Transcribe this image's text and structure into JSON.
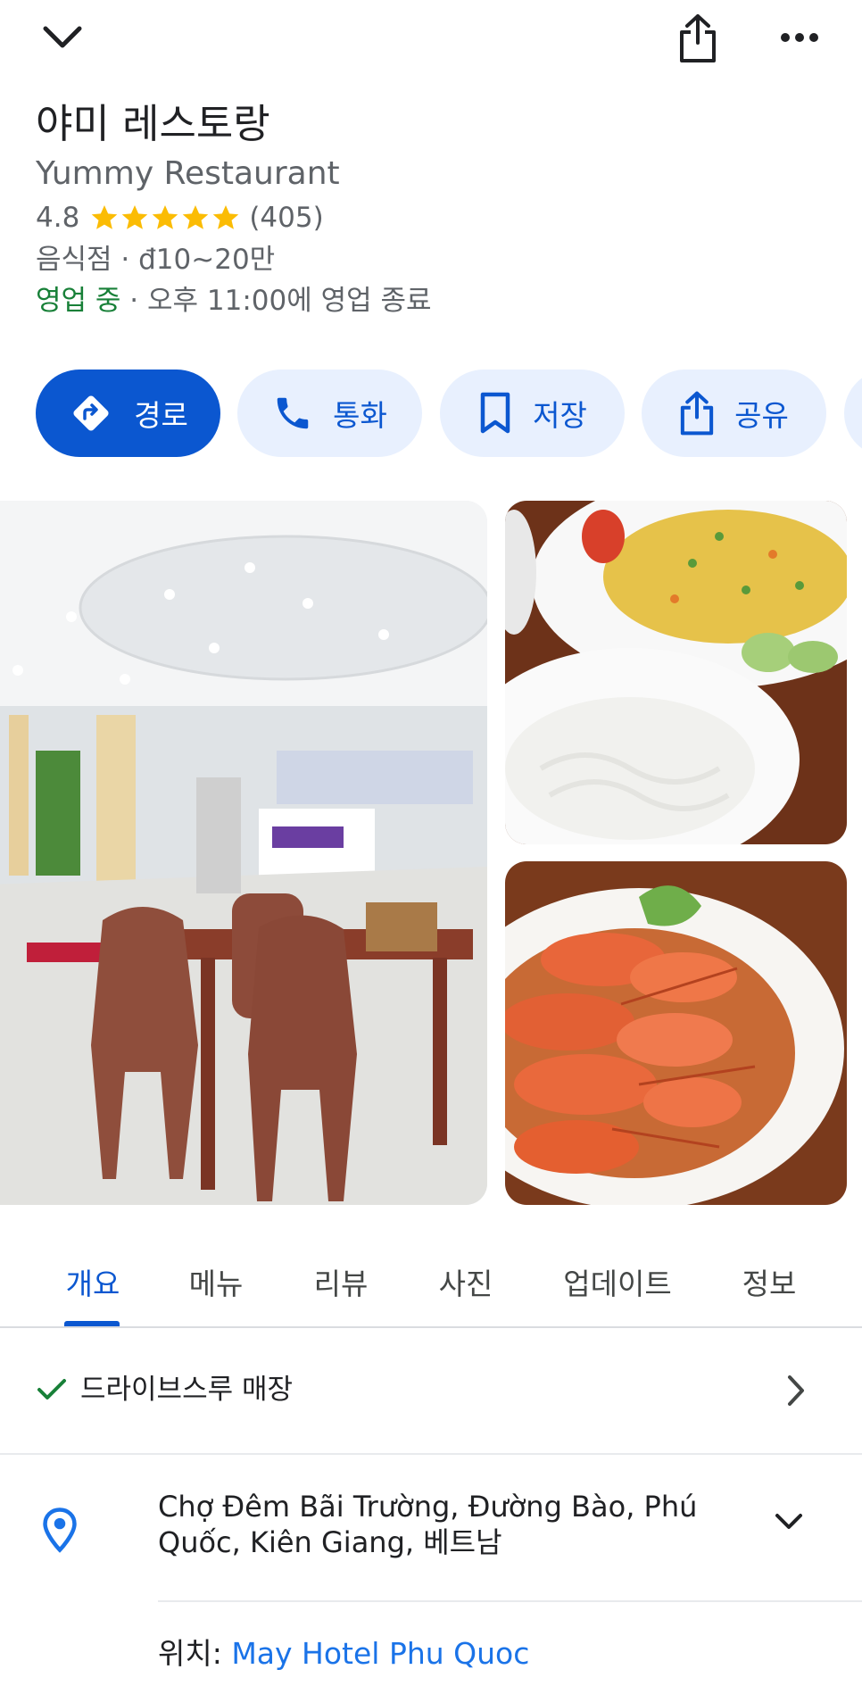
{
  "topbar": {
    "back_icon": "chevron-down-icon",
    "share_icon": "share-icon",
    "more_icon": "more-horizontal-icon"
  },
  "place": {
    "name": "야미 레스토랑",
    "name_en": "Yummy Restaurant",
    "rating": "4.8",
    "stars": 5,
    "review_count": "(405)",
    "category": "음식점",
    "separator": " · ",
    "price": "đ10~20만",
    "open_status": "영업 중",
    "hours_sep": " · ",
    "hours": "오후 11:00에 영업 종료",
    "star_color": "#fbbc04",
    "open_color": "#188038"
  },
  "actions": [
    {
      "label": "경로",
      "icon": "directions-icon"
    },
    {
      "label": "통화",
      "icon": "phone-icon"
    },
    {
      "label": "저장",
      "icon": "bookmark-icon"
    },
    {
      "label": "공유",
      "icon": "share-icon"
    }
  ],
  "tabs": [
    "개요",
    "메뉴",
    "리뷰",
    "사진",
    "업데이트",
    "정보"
  ],
  "active_tab": 0,
  "features": {
    "drive_through": "드라이브스루 매장"
  },
  "address": {
    "text": "Chợ Đêm Bãi Trường, Đường Bào, Phú Quốc, Kiên Giang, 베트남"
  },
  "located_in": {
    "label": "위치: ",
    "place": "May Hotel Phu Quoc"
  },
  "colors": {
    "accent": "#0b57d0",
    "chip_bg": "#e8f0fe",
    "link": "#1a73e8"
  }
}
